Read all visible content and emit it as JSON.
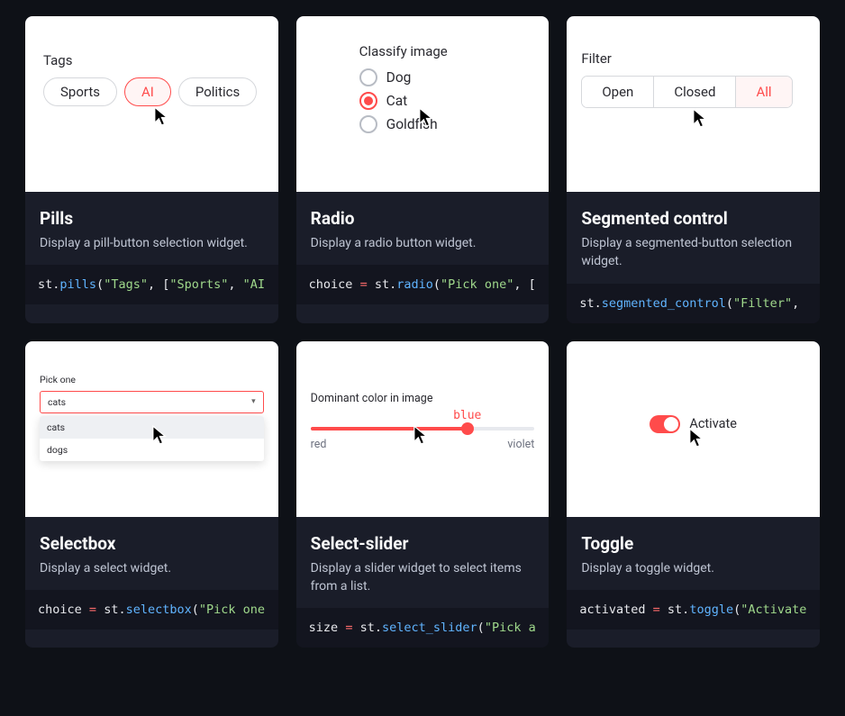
{
  "cards": {
    "pills": {
      "preview_label": "Tags",
      "options": [
        "Sports",
        "AI",
        "Politics"
      ],
      "selected": "AI",
      "title": "Pills",
      "subtitle": "Display a pill-button selection widget.",
      "code": {
        "fn": "pills",
        "str1": "\"Tags\"",
        "str2": "\"Sports\"",
        "str3": "\"AI"
      }
    },
    "radio": {
      "preview_label": "Classify image",
      "options": [
        "Dog",
        "Cat",
        "Goldfish"
      ],
      "selected": "Cat",
      "title": "Radio",
      "subtitle": "Display a radio button widget.",
      "code": {
        "var": "choice",
        "fn": "radio",
        "str1": "\"Pick one\""
      }
    },
    "segmented": {
      "preview_label": "Filter",
      "options": [
        "Open",
        "Closed",
        "All"
      ],
      "selected": "All",
      "title": "Segmented control",
      "subtitle": "Display a segmented-button selection widget.",
      "code": {
        "fn": "segmented_control",
        "str1": "\"Filter\""
      }
    },
    "selectbox": {
      "preview_label": "Pick one",
      "value": "cats",
      "menu": [
        "cats",
        "dogs"
      ],
      "title": "Selectbox",
      "subtitle": "Display a select widget.",
      "code": {
        "var": "choice",
        "fn": "selectbox",
        "str1": "\"Pick one"
      }
    },
    "select_slider": {
      "preview_label": "Dominant color in image",
      "value": "blue",
      "min_label": "red",
      "max_label": "violet",
      "title": "Select-slider",
      "subtitle": "Display a slider widget to select items from a list.",
      "code": {
        "var": "size",
        "fn": "select_slider",
        "str1": "\"Pick a"
      }
    },
    "toggle": {
      "preview_label": "Activate",
      "value": true,
      "title": "Toggle",
      "subtitle": "Display a toggle widget.",
      "code": {
        "var": "activated",
        "fn": "toggle",
        "str1": "\"Activate"
      }
    }
  },
  "st_prefix": "st"
}
